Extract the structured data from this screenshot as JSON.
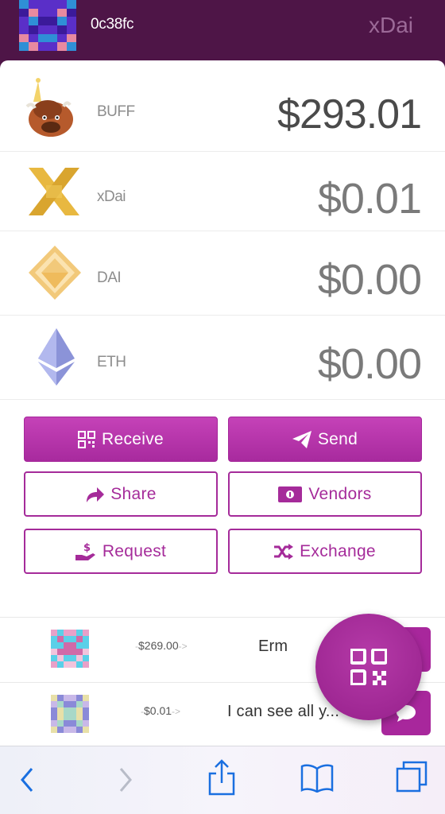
{
  "header": {
    "address": "0c38fc",
    "network": "xDai"
  },
  "tokens": [
    {
      "name": "BUFF",
      "balance": "$293.01",
      "icon": "buffalo-icon"
    },
    {
      "name": "xDai",
      "balance": "$0.01",
      "icon": "xdai-icon"
    },
    {
      "name": "DAI",
      "balance": "$0.00",
      "icon": "dai-icon"
    },
    {
      "name": "ETH",
      "balance": "$0.00",
      "icon": "eth-icon"
    }
  ],
  "actions": {
    "receive": "Receive",
    "send": "Send",
    "share": "Share",
    "vendors": "Vendors",
    "request": "Request",
    "exchange": "Exchange"
  },
  "transactions": [
    {
      "amount": "$269.00",
      "message": "Erm"
    },
    {
      "amount": "$0.01",
      "message": "I can see all y..."
    }
  ],
  "colors": {
    "header_bg": "#4e1547",
    "accent": "#a52b9a"
  }
}
